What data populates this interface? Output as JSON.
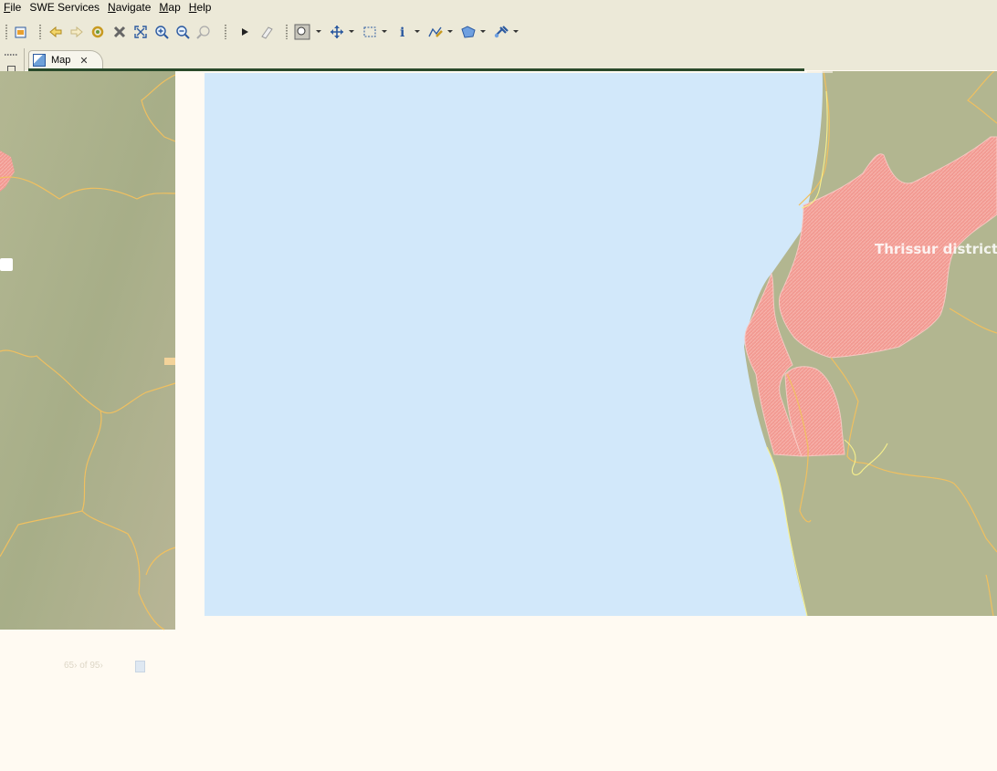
{
  "menu": [
    {
      "accel": "F",
      "rest": "ile"
    },
    {
      "accel": "",
      "rest": "SWE Services"
    },
    {
      "accel": "N",
      "rest": "avigate"
    },
    {
      "accel": "M",
      "rest": "ap"
    },
    {
      "accel": "H",
      "rest": "elp"
    }
  ],
  "tab": {
    "label": "Map"
  },
  "status": {
    "memory": "65› of 95›"
  },
  "map": {
    "water_color": "#d2e8fa",
    "land_color": "#a8b28a",
    "region_color": "#f29a92",
    "boundary_color": "#f0c060",
    "label": "Thrissur district"
  },
  "toolbar_icons": [
    "new-map-icon",
    "back-icon",
    "forward-icon",
    "refresh-icon",
    "stop-icon",
    "zoom-extent-icon",
    "zoom-in-icon",
    "zoom-out-icon",
    "zoom-selection-icon",
    "run-icon",
    "eraser-icon",
    "zoom-tool-icon",
    "pan-tool-icon",
    "select-tool-icon",
    "info-tool-icon",
    "edit-tool-icon",
    "feature-tool-icon",
    "plugin-tool-icon"
  ]
}
